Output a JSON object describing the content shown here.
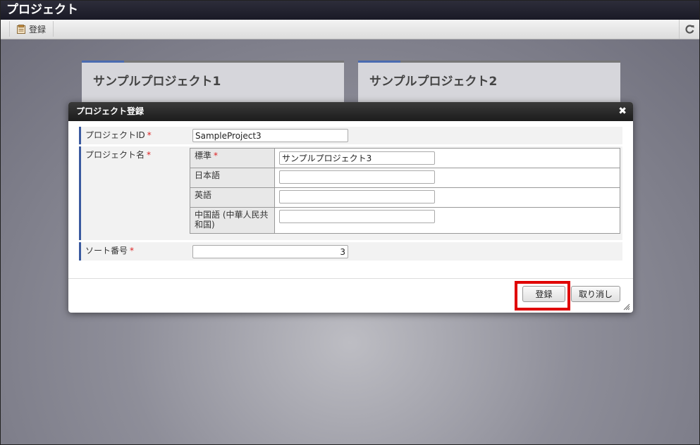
{
  "window": {
    "title": "プロジェクト"
  },
  "toolbar": {
    "register_label": "登録",
    "refresh_icon": "refresh-icon"
  },
  "cards": [
    {
      "title": "サンプルプロジェクト1"
    },
    {
      "title": "サンプルプロジェクト2"
    }
  ],
  "dialog": {
    "title": "プロジェクト登録",
    "close_icon": "✖",
    "fields": {
      "project_id": {
        "label": "プロジェクトID",
        "required": "*",
        "value": "SampleProject3"
      },
      "project_name": {
        "label": "プロジェクト名",
        "required": "*",
        "languages": [
          {
            "label": "標準",
            "required": "*",
            "value": "サンプルプロジェクト3"
          },
          {
            "label": "日本語",
            "value": ""
          },
          {
            "label": "英語",
            "value": ""
          },
          {
            "label": "中国語 (中華人民共和国)",
            "value": ""
          }
        ]
      },
      "sort_number": {
        "label": "ソート番号",
        "required": "*",
        "value": "3"
      }
    },
    "buttons": {
      "register": "登録",
      "cancel": "取り消し"
    }
  },
  "colors": {
    "highlight": "#e00000",
    "accent": "#3a5aa0",
    "required": "#d22222"
  }
}
